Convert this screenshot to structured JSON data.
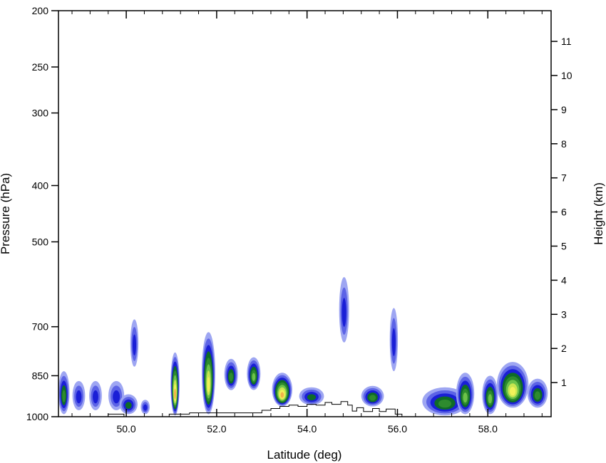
{
  "chart_data": {
    "type": "heatmap",
    "title": "",
    "xlabel": "Latitude (deg)",
    "ylabel_left": "Pressure (hPa)",
    "ylabel_right": "Height (km)",
    "xlim": [
      48.5,
      59.4
    ],
    "ylim_pressure": [
      1000,
      200
    ],
    "ylim_height_km": [
      0,
      11.9
    ],
    "y_scale": "log-pressure",
    "grid": false,
    "legend": "none",
    "x_ticks": [
      {
        "value": 50,
        "label": "50.0"
      },
      {
        "value": 52,
        "label": "52.0"
      },
      {
        "value": 54,
        "label": "54.0"
      },
      {
        "value": 56,
        "label": "56.0"
      },
      {
        "value": 58,
        "label": "58.0"
      }
    ],
    "x_minor_tick_step": 0.4,
    "pressure_ticks": [
      {
        "value": 200,
        "label": "200"
      },
      {
        "value": 250,
        "label": "250"
      },
      {
        "value": 300,
        "label": "300"
      },
      {
        "value": 400,
        "label": "400"
      },
      {
        "value": 500,
        "label": "500"
      },
      {
        "value": 700,
        "label": "700"
      },
      {
        "value": 850,
        "label": "850"
      },
      {
        "value": 1000,
        "label": "1000"
      }
    ],
    "height_ticks": [
      {
        "value": 1,
        "label": "1"
      },
      {
        "value": 2,
        "label": "2"
      },
      {
        "value": 3,
        "label": "3"
      },
      {
        "value": 4,
        "label": "4"
      },
      {
        "value": 5,
        "label": "5"
      },
      {
        "value": 6,
        "label": "6"
      },
      {
        "value": 7,
        "label": "7"
      },
      {
        "value": 8,
        "label": "8"
      },
      {
        "value": 9,
        "label": "9"
      },
      {
        "value": 10,
        "label": "10"
      },
      {
        "value": 11,
        "label": "11"
      }
    ],
    "colors": {
      "level1": "#9ea6f2",
      "level2": "#5c63e6",
      "level3": "#1a1fd6",
      "level4": "#0f6b28",
      "level5": "#2e8b2e",
      "level6": "#6cc24a",
      "level7": "#c8e650",
      "level8": "#f2f25a",
      "level9": "#f2b44a"
    },
    "cells": [
      {
        "lat": 48.62,
        "p0": 990,
        "p1": 835,
        "w": 0.25,
        "max": 5
      },
      {
        "lat": 48.95,
        "p0": 975,
        "p1": 868,
        "w": 0.28,
        "max": 3
      },
      {
        "lat": 49.32,
        "p0": 975,
        "p1": 868,
        "w": 0.28,
        "max": 3
      },
      {
        "lat": 49.78,
        "p0": 975,
        "p1": 868,
        "w": 0.35,
        "max": 3
      },
      {
        "lat": 50.05,
        "p0": 990,
        "p1": 915,
        "w": 0.4,
        "max": 4
      },
      {
        "lat": 50.18,
        "p0": 820,
        "p1": 680,
        "w": 0.18,
        "max": 3
      },
      {
        "lat": 50.42,
        "p0": 990,
        "p1": 935,
        "w": 0.2,
        "max": 3
      },
      {
        "lat": 51.08,
        "p0": 995,
        "p1": 775,
        "w": 0.2,
        "max": 9
      },
      {
        "lat": 51.82,
        "p0": 990,
        "p1": 715,
        "w": 0.3,
        "max": 8
      },
      {
        "lat": 52.32,
        "p0": 900,
        "p1": 795,
        "w": 0.3,
        "max": 5
      },
      {
        "lat": 52.82,
        "p0": 900,
        "p1": 790,
        "w": 0.3,
        "max": 6
      },
      {
        "lat": 53.45,
        "p0": 960,
        "p1": 840,
        "w": 0.45,
        "max": 9
      },
      {
        "lat": 54.1,
        "p0": 955,
        "p1": 890,
        "w": 0.55,
        "max": 4
      },
      {
        "lat": 54.82,
        "p0": 745,
        "p1": 575,
        "w": 0.22,
        "max": 3
      },
      {
        "lat": 55.45,
        "p0": 960,
        "p1": 885,
        "w": 0.5,
        "max": 5
      },
      {
        "lat": 55.92,
        "p0": 835,
        "p1": 650,
        "w": 0.18,
        "max": 3
      },
      {
        "lat": 57.05,
        "p0": 995,
        "p1": 890,
        "w": 1.0,
        "max": 5
      },
      {
        "lat": 57.5,
        "p0": 990,
        "p1": 840,
        "w": 0.4,
        "max": 6
      },
      {
        "lat": 58.05,
        "p0": 990,
        "p1": 850,
        "w": 0.35,
        "max": 6
      },
      {
        "lat": 58.55,
        "p0": 965,
        "p1": 805,
        "w": 0.7,
        "max": 8
      },
      {
        "lat": 59.1,
        "p0": 965,
        "p1": 860,
        "w": 0.45,
        "max": 5
      }
    ],
    "terrain": [
      {
        "lat": 48.5,
        "p": 1000
      },
      {
        "lat": 49.5,
        "p": 1000
      },
      {
        "lat": 49.6,
        "p": 990
      },
      {
        "lat": 49.85,
        "p": 990
      },
      {
        "lat": 49.95,
        "p": 1000
      },
      {
        "lat": 50.85,
        "p": 1000
      },
      {
        "lat": 50.95,
        "p": 990
      },
      {
        "lat": 51.3,
        "p": 990
      },
      {
        "lat": 51.4,
        "p": 985
      },
      {
        "lat": 52.9,
        "p": 985
      },
      {
        "lat": 53.0,
        "p": 975
      },
      {
        "lat": 53.2,
        "p": 968
      },
      {
        "lat": 53.4,
        "p": 960
      },
      {
        "lat": 53.6,
        "p": 955
      },
      {
        "lat": 53.8,
        "p": 960
      },
      {
        "lat": 54.0,
        "p": 952
      },
      {
        "lat": 54.2,
        "p": 955
      },
      {
        "lat": 54.4,
        "p": 945
      },
      {
        "lat": 54.55,
        "p": 952
      },
      {
        "lat": 54.75,
        "p": 942
      },
      {
        "lat": 54.9,
        "p": 955
      },
      {
        "lat": 55.0,
        "p": 978
      },
      {
        "lat": 55.1,
        "p": 965
      },
      {
        "lat": 55.25,
        "p": 980
      },
      {
        "lat": 55.45,
        "p": 968
      },
      {
        "lat": 55.6,
        "p": 980
      },
      {
        "lat": 55.75,
        "p": 970
      },
      {
        "lat": 55.95,
        "p": 990
      },
      {
        "lat": 56.1,
        "p": 1000
      },
      {
        "lat": 59.4,
        "p": 1000
      }
    ]
  }
}
